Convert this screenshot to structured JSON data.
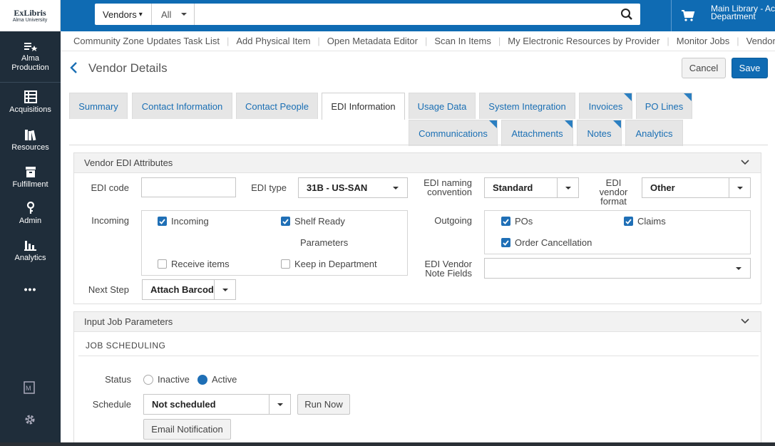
{
  "logo": {
    "line1": "ExLibris",
    "line2": "Alma University"
  },
  "leftnav": {
    "items": [
      {
        "label": "Alma\nProduction",
        "icon": "tasks-star-icon"
      },
      {
        "label": "Acquisitions",
        "icon": "acquisitions-icon"
      },
      {
        "label": "Resources",
        "icon": "books-icon"
      },
      {
        "label": "Fulfillment",
        "icon": "archive-icon"
      },
      {
        "label": "Admin",
        "icon": "key-icon"
      },
      {
        "label": "Analytics",
        "icon": "bar-chart-icon"
      }
    ],
    "more": "•••"
  },
  "search": {
    "scope": "Vendors",
    "scope_caret": "▾",
    "filter": "All",
    "placeholder": ""
  },
  "location": {
    "line1": "Main Library - Ac",
    "line2": "Department"
  },
  "links": [
    "Community Zone Updates Task List",
    "Add Physical Item",
    "Open Metadata Editor",
    "Scan In Items",
    "My Electronic Resources by Provider",
    "Monitor Jobs",
    "Vendors"
  ],
  "page": {
    "title": "Vendor Details",
    "cancel": "Cancel",
    "save": "Save"
  },
  "tabs": {
    "row1": [
      "Summary",
      "Contact Information",
      "Contact People",
      "EDI Information",
      "Usage Data",
      "System Integration",
      "Invoices",
      "PO Lines"
    ],
    "row2": [
      "Communications",
      "Attachments",
      "Notes",
      "Analytics"
    ],
    "active": "EDI Information"
  },
  "edi": {
    "heading": "Vendor EDI Attributes",
    "edi_code_label": "EDI code",
    "edi_code_value": "",
    "edi_type_label": "EDI type",
    "edi_type_value": "31B - US-SAN",
    "naming_label_1": "EDI naming",
    "naming_label_2": "convention",
    "naming_value": "Standard",
    "format_label_1": "EDI",
    "format_label_2": "vendor",
    "format_label_3": "format",
    "format_value": "Other",
    "incoming_label": "Incoming",
    "incoming_cb": "Incoming",
    "shelf_ready_cb": "Shelf Ready",
    "parameters_label": "Parameters",
    "receive_items_cb": "Receive items",
    "keep_in_dept_cb": "Keep in Department",
    "outgoing_label": "Outgoing",
    "pos_cb": "POs",
    "claims_cb": "Claims",
    "order_cancel_cb": "Order Cancellation",
    "note_fields_label_1": "EDI Vendor",
    "note_fields_label_2": "Note Fields",
    "note_fields_value": "",
    "next_step_label": "Next Step",
    "next_step_value": "Attach Barcod"
  },
  "checkboxes": {
    "incoming": true,
    "shelf_ready": true,
    "receive_items": false,
    "keep_in_department": false,
    "pos": true,
    "claims": true,
    "order_cancellation": true
  },
  "job": {
    "heading": "Input Job Parameters",
    "section": "JOB SCHEDULING",
    "status_label": "Status",
    "status_inactive": "Inactive",
    "status_active": "Active",
    "status_selected": "Active",
    "schedule_label": "Schedule",
    "schedule_value": "Not scheduled",
    "run_now": "Run Now",
    "email_notification": "Email Notification"
  },
  "colors": {
    "nav_bg": "#1f2d3a",
    "topbar": "#0f6bb3",
    "accent": "#1f6fb6",
    "link": "#1a6fb4"
  }
}
